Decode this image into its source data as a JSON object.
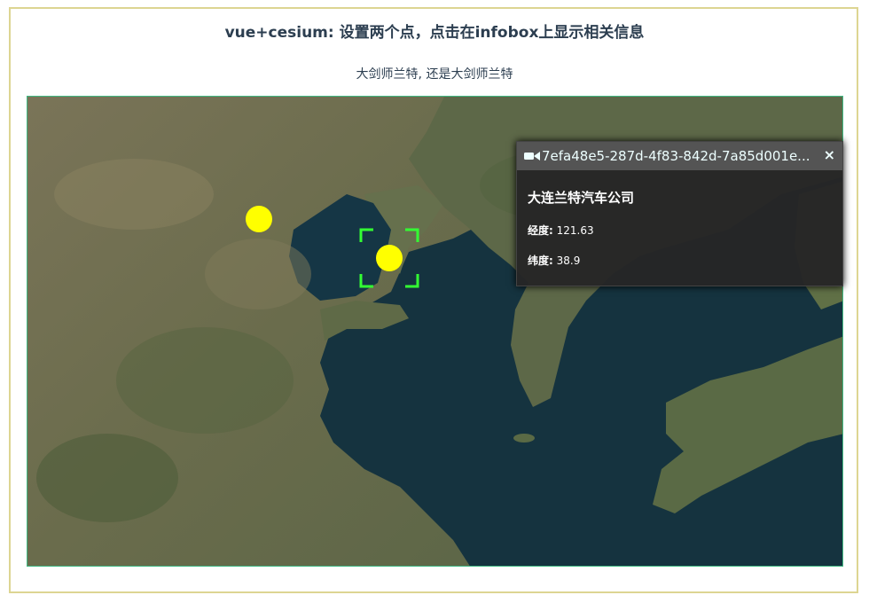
{
  "page": {
    "title": "vue+cesium: 设置两个点，点击在infobox上显示相关信息",
    "subtitle": "大剑师兰特, 还是大剑师兰特"
  },
  "map": {
    "points": [
      {
        "name": "point-1",
        "color": "#ffff00"
      },
      {
        "name": "point-2-selected",
        "color": "#ffff00"
      }
    ],
    "selection_color": "#33ff33"
  },
  "infobox": {
    "camera_icon": "camera-icon",
    "entity_id": "7efa48e5-287d-4f83-842d-7a85d001e...",
    "close_label": "×",
    "name": "大连兰特汽车公司",
    "longitude_label": "经度:",
    "longitude_value": "121.63",
    "latitude_label": "纬度:",
    "latitude_value": "38.9"
  },
  "colors": {
    "frame_border": "#ddd592",
    "map_border": "#41b883",
    "infobox_bg": "#262626",
    "infobox_header": "#545454"
  }
}
